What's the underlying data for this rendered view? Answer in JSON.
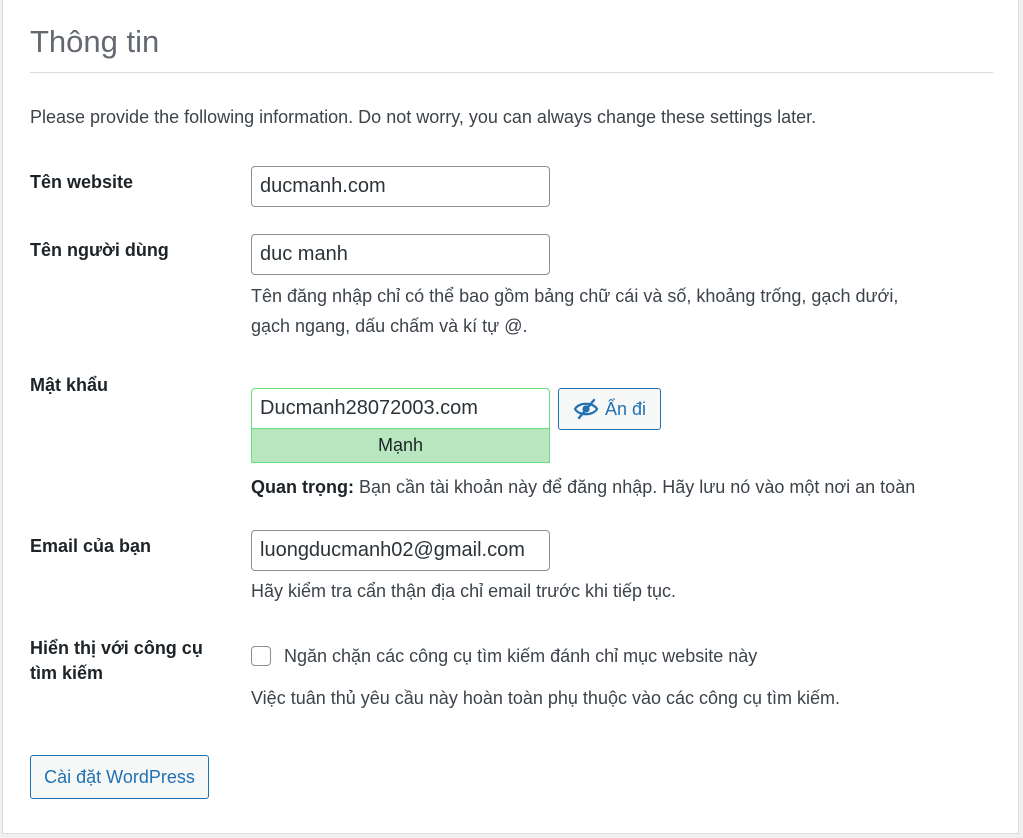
{
  "page": {
    "title": "Thông tin",
    "intro": "Please provide the following information. Do not worry, you can always change these settings later."
  },
  "site_name": {
    "label": "Tên website",
    "value": "ducmanh.com"
  },
  "username": {
    "label": "Tên người dùng",
    "value": "duc manh",
    "hint_line1": "Tên đăng nhập chỉ có thể bao gồm bảng chữ cái và số, khoảng trống, gạch dưới,",
    "hint_line2": "gạch ngang, dấu chấm và kí tự @."
  },
  "password": {
    "label": "Mật khẩu",
    "value": "Ducmanh28072003.com",
    "strength": "Mạnh",
    "hide_label": "Ẩn đi",
    "hide_icon": "eye-slash-icon",
    "important_prefix": "Quan trọng:",
    "important_text": " Bạn cần tài khoản này để đăng nhập. Hãy lưu nó vào một nơi an toàn",
    "strength_color": "#b8e6bf",
    "border_color": "#68de7c"
  },
  "email": {
    "label": "Email của bạn",
    "value": "luongducmanh02@gmail.com",
    "hint": "Hãy kiểm tra cẩn thận địa chỉ email trước khi tiếp tục."
  },
  "search_visibility": {
    "label_line1": "Hiển thị với công cụ",
    "label_line2": "tìm kiếm",
    "checkbox_label": "Ngăn chặn các công cụ tìm kiếm đánh chỉ mục website này",
    "checked": false,
    "hint": "Việc tuân thủ yêu cầu này hoàn toàn phụ thuộc vào các công cụ tìm kiếm."
  },
  "submit": {
    "label": "Cài đặt WordPress"
  },
  "colors": {
    "accent": "#2271b1",
    "text": "#3c434a",
    "title": "#646970"
  }
}
